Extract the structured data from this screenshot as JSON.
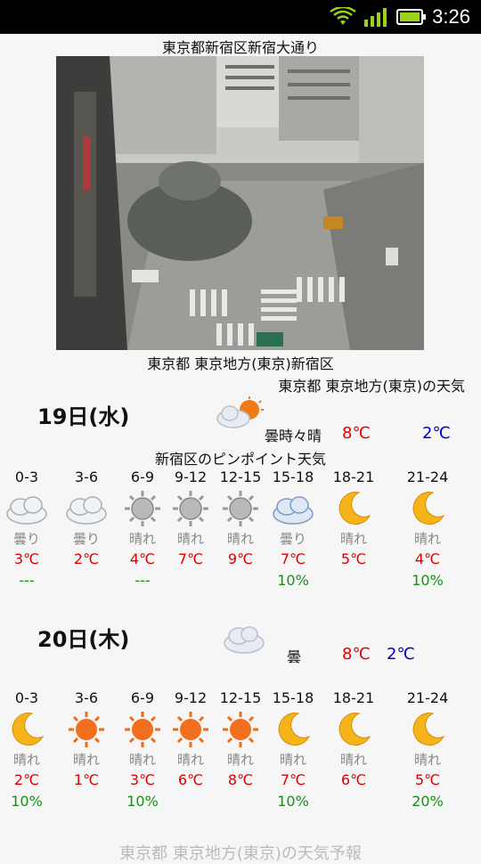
{
  "status": {
    "time": "3:26"
  },
  "location": "東京都新宿区新宿大通り",
  "camera_caption": "東京都 東京地方(東京)新宿区",
  "area_weather_title": "東京都 東京地方(東京)の天気",
  "days": [
    {
      "date": "19日(水)",
      "summary_icon": "cloud-sun-icon",
      "summary": "曇時々晴",
      "high": "8℃",
      "low": "2℃",
      "pinpoint_title": "新宿区のピンポイント天気",
      "slots": [
        {
          "hour": "0-3",
          "icon": "cloud-icon",
          "cond": "曇り",
          "temp": "3℃",
          "rain": "---"
        },
        {
          "hour": "3-6",
          "icon": "cloud-icon",
          "cond": "曇り",
          "temp": "2℃",
          "rain": ""
        },
        {
          "hour": "6-9",
          "icon": "gray-sun-icon",
          "cond": "晴れ",
          "temp": "4℃",
          "rain": "---"
        },
        {
          "hour": "9-12",
          "icon": "gray-sun-icon",
          "cond": "晴れ",
          "temp": "7℃",
          "rain": ""
        },
        {
          "hour": "12-15",
          "icon": "gray-sun-icon",
          "cond": "晴れ",
          "temp": "9℃",
          "rain": ""
        },
        {
          "hour": "15-18",
          "icon": "blue-cloud-icon",
          "cond": "曇り",
          "temp": "7℃",
          "rain": "10%"
        },
        {
          "hour": "18-21",
          "icon": "moon-icon",
          "cond": "晴れ",
          "temp": "5℃",
          "rain": ""
        },
        {
          "hour": "21-24",
          "icon": "moon-icon",
          "cond": "晴れ",
          "temp": "4℃",
          "rain": "10%"
        }
      ]
    },
    {
      "date": "20日(木)",
      "summary_icon": "cloud-icon",
      "summary": "曇",
      "high": "8℃",
      "low": "2℃",
      "slots": [
        {
          "hour": "0-3",
          "icon": "moon-icon",
          "cond": "晴れ",
          "temp": "2℃",
          "rain": "10%"
        },
        {
          "hour": "3-6",
          "icon": "sun-icon",
          "cond": "晴れ",
          "temp": "1℃",
          "rain": ""
        },
        {
          "hour": "6-9",
          "icon": "sun-icon",
          "cond": "晴れ",
          "temp": "3℃",
          "rain": "10%"
        },
        {
          "hour": "9-12",
          "icon": "sun-icon",
          "cond": "晴れ",
          "temp": "6℃",
          "rain": ""
        },
        {
          "hour": "12-15",
          "icon": "sun-icon",
          "cond": "晴れ",
          "temp": "8℃",
          "rain": ""
        },
        {
          "hour": "15-18",
          "icon": "moon-icon",
          "cond": "晴れ",
          "temp": "7℃",
          "rain": "10%"
        },
        {
          "hour": "18-21",
          "icon": "moon-icon",
          "cond": "晴れ",
          "temp": "6℃",
          "rain": ""
        },
        {
          "hour": "21-24",
          "icon": "moon-icon",
          "cond": "晴れ",
          "temp": "5℃",
          "rain": "20%"
        }
      ]
    }
  ],
  "footer": "東京都 東京地方(東京)の天気予報"
}
